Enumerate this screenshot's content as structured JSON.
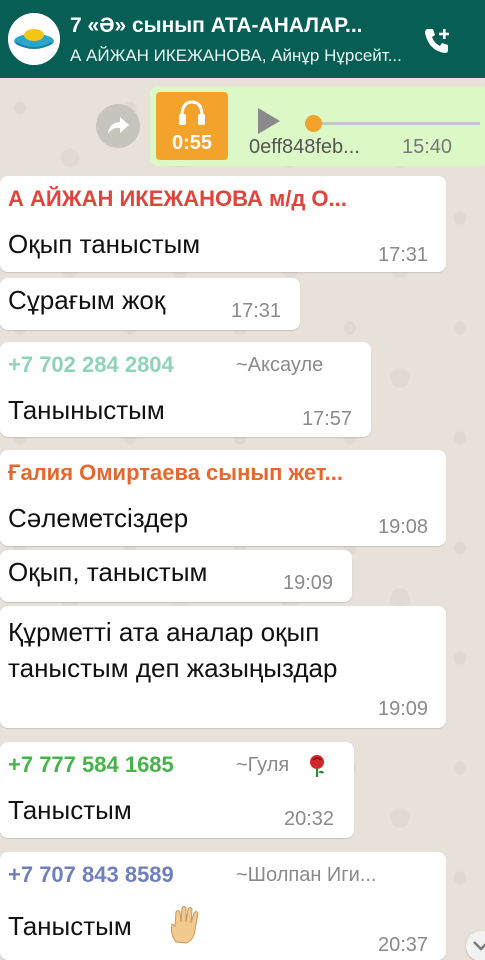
{
  "header": {
    "title": "7 «Ә» сынып АТА-АНАЛАР...",
    "subtitle": "А АЙЖАН ИКЕЖАНОВА, Айнұр Нұрсейт...",
    "call_icon": "add-call-icon"
  },
  "voice_message": {
    "duration": "0:55",
    "file_name": "0eff848feb...",
    "time": "15:40",
    "progress": 0.0
  },
  "messages": [
    {
      "sender": "А АЙЖАН ИКЕЖАНОВА м/д О...",
      "sender_color": "#e0443c",
      "text": "Оқып таныстым",
      "time": "17:31"
    },
    {
      "text": "Сұрағым жоқ",
      "time": "17:31"
    },
    {
      "sender": "+7 702 284 2804",
      "sender_color": "#8fd3b6",
      "pushname": "~Аксауле",
      "text": "Таныныстым",
      "time": "17:57"
    },
    {
      "sender": "Ғалия Омиртаева сынып жет...",
      "sender_color": "#e8672d",
      "text": "Сәлеметсіздер",
      "time": "19:08"
    },
    {
      "text": "Оқып, таныстым",
      "time": "19:09"
    },
    {
      "text_line1": "Құрметті ата аналар оқып",
      "text_line2": "таныстым деп жазыңыздар",
      "time": "19:09"
    },
    {
      "sender": "+7 777 584 1685",
      "sender_color": "#46b34a",
      "pushname": "~Гуля",
      "text": "Таныстым",
      "time": "20:32"
    },
    {
      "sender": "+7 707 843 8589",
      "sender_color": "#6f7fbd",
      "pushname": "~Шолпан Иги...",
      "text": "Таныстым",
      "time": "20:37"
    }
  ],
  "colors": {
    "header": "#075e54",
    "outgoing_bubble": "#dcf8c6",
    "incoming_bubble": "#ffffff",
    "voice_thumb": "#f3a22b"
  }
}
